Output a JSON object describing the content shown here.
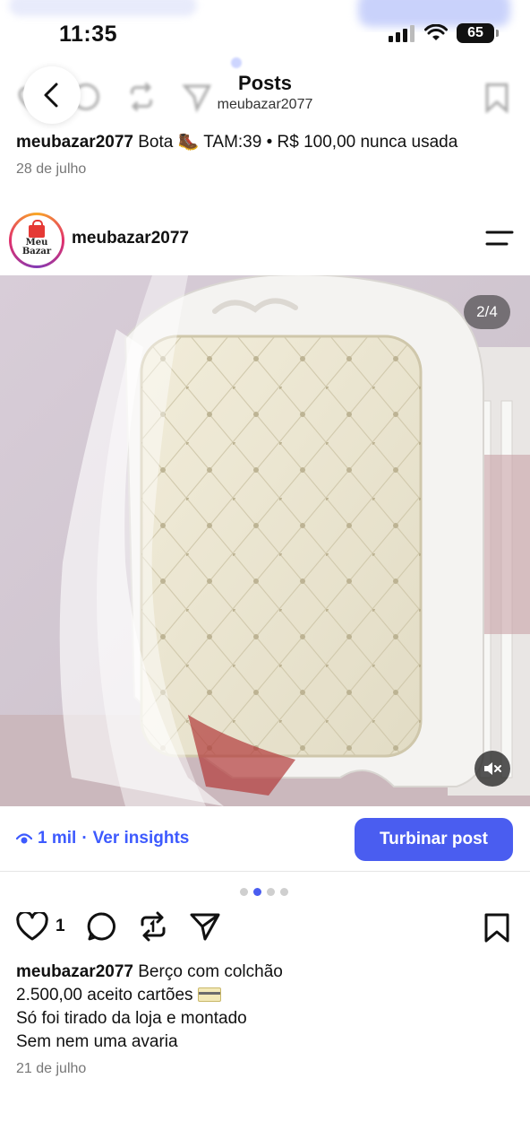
{
  "status_bar": {
    "time": "11:35",
    "battery": "65"
  },
  "header": {
    "title": "Posts",
    "subtitle": "meubazar2077"
  },
  "previous_post": {
    "username": "meubazar2077",
    "caption": "Bota 🥾 TAM:39 • R$ 100,00 nunca usada",
    "date": "28 de julho"
  },
  "post": {
    "username": "meubazar2077",
    "avatar_text_line1": "Meu",
    "avatar_text_line2": "Bazar",
    "image_counter": "2/4",
    "views": "1 mil",
    "insights_sep": "·",
    "insights_link": "Ver insights",
    "boost_button": "Turbinar post",
    "carousel": {
      "count": 4,
      "active_index": 1
    },
    "like_count": "1",
    "caption_username": "meubazar2077",
    "caption_line1": "Berço com colchão",
    "caption_line2": "2.500,00 aceito cartões",
    "caption_line3": "Só foi tirado da loja e montado",
    "caption_line4": "Sem nem uma avaria",
    "date": "21 de julho"
  },
  "colors": {
    "accent": "#4a5df0",
    "link": "#3d5afe"
  },
  "icons": [
    "back-arrow-icon",
    "signal-icon",
    "wifi-icon",
    "battery-icon",
    "menu-icon",
    "mute-icon",
    "eye-icon",
    "heart-icon",
    "comment-icon",
    "repost-icon",
    "share-icon",
    "bookmark-icon"
  ]
}
